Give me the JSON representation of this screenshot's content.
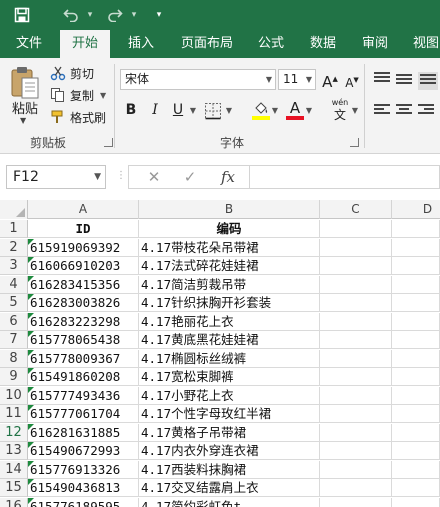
{
  "quick_access": {
    "save_icon": "save-icon",
    "undo_icon": "undo-icon",
    "redo_icon": "redo-icon",
    "dropdown_glyph": "▾",
    "customize_glyph": "▾"
  },
  "tabs": [
    {
      "label": "文件",
      "active": false
    },
    {
      "label": "开始",
      "active": true
    },
    {
      "label": "插入",
      "active": false
    },
    {
      "label": "页面布局",
      "active": false
    },
    {
      "label": "公式",
      "active": false
    },
    {
      "label": "数据",
      "active": false
    },
    {
      "label": "审阅",
      "active": false
    },
    {
      "label": "视图",
      "active": false
    }
  ],
  "ribbon": {
    "clipboard": {
      "paste_label": "粘贴",
      "cut_label": "剪切",
      "copy_label": "复制",
      "format_painter_label": "格式刷",
      "group_label": "剪贴板"
    },
    "font": {
      "font_name": "宋体",
      "font_size": "11",
      "grow_glyph": "A",
      "shrink_glyph": "A",
      "bold_glyph": "B",
      "italic_glyph": "I",
      "underline_glyph": "U",
      "font_color_glyph": "A",
      "phonetic_top": "wén",
      "phonetic_bottom": "文",
      "group_label": "字体",
      "highlight_color": "#ffff00",
      "font_color": "#e81123"
    }
  },
  "formula_bar": {
    "name_box": "F12",
    "cancel_glyph": "✕",
    "enter_glyph": "✓",
    "fx_label": "fx",
    "formula": ""
  },
  "sheet": {
    "columns": [
      "A",
      "B",
      "C",
      "D"
    ],
    "rows": [
      {
        "n": "1",
        "a": "ID",
        "b": "编码",
        "header": true
      },
      {
        "n": "2",
        "a": "615919069392",
        "b": "4.17带枝花朵吊带裙"
      },
      {
        "n": "3",
        "a": "616066910203",
        "b": "4.17法式碎花娃娃裙"
      },
      {
        "n": "4",
        "a": "616283415356",
        "b": "4.17简洁剪裁吊带"
      },
      {
        "n": "5",
        "a": "616283003826",
        "b": "4.17针织抹胸开衫套装"
      },
      {
        "n": "6",
        "a": "616283223298",
        "b": "4.17艳丽花上衣"
      },
      {
        "n": "7",
        "a": "615778065438",
        "b": "4.17黄底黑花娃娃裙"
      },
      {
        "n": "8",
        "a": "615778009367",
        "b": "4.17椭圆标丝绒裤"
      },
      {
        "n": "9",
        "a": "615491860208",
        "b": "4.17宽松束脚裤"
      },
      {
        "n": "10",
        "a": "615777493436",
        "b": "4.17小野花上衣"
      },
      {
        "n": "11",
        "a": "615777061704",
        "b": "4.17个性字母玫红半裙"
      },
      {
        "n": "12",
        "a": "616281631885",
        "b": "4.17黄格子吊带裙"
      },
      {
        "n": "13",
        "a": "615490672993",
        "b": "4.17内衣外穿连衣裙"
      },
      {
        "n": "14",
        "a": "615776913326",
        "b": "4.17西装料抹胸裙"
      },
      {
        "n": "15",
        "a": "615490436813",
        "b": "4.17交叉结露肩上衣"
      },
      {
        "n": "16",
        "a": "615776189595",
        "b": "4.17简约彩虹色t"
      }
    ]
  }
}
